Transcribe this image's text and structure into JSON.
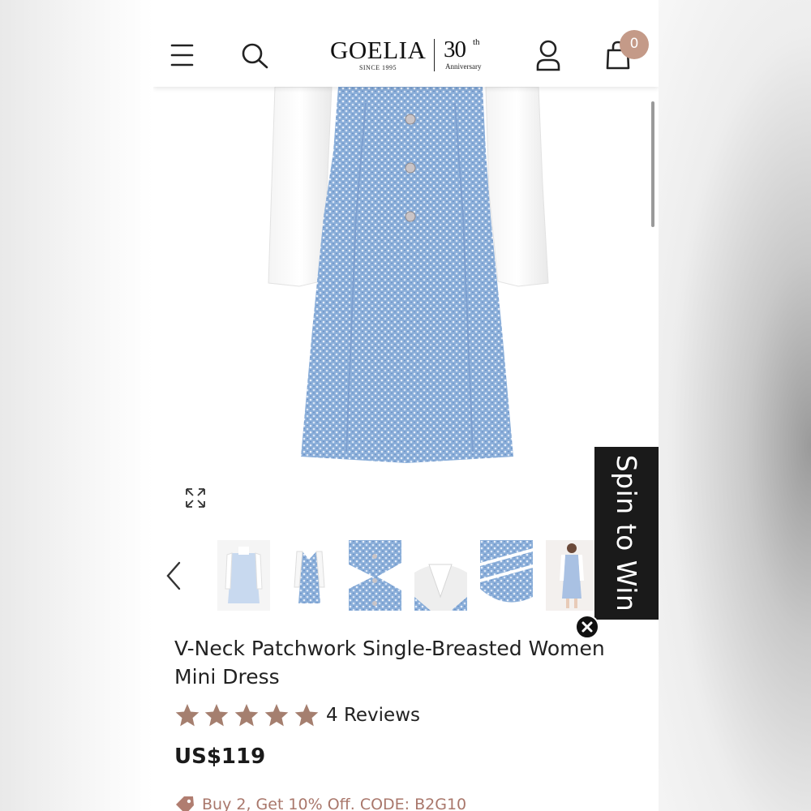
{
  "header": {
    "brand_name": "GOELIA",
    "brand_since": "SINCE 1995",
    "anniversary_number": "30",
    "anniversary_suffix": "th",
    "anniversary_label": "Anniversary",
    "cart_count": "0"
  },
  "icons": {
    "menu": "hamburger-menu-icon",
    "search": "search-icon",
    "account": "user-icon",
    "cart": "shopping-bag-icon",
    "expand": "expand-icon",
    "prev": "chevron-left-icon",
    "close": "close-icon",
    "promo": "tag-icon"
  },
  "spin_banner": {
    "label": "Spin to Win"
  },
  "thumbnails": {
    "count": 6
  },
  "product": {
    "title": "V-Neck Patchwork Single-Breasted Women Mini Dress",
    "rating": 5,
    "rating_max": 5,
    "reviews_label": "4 Reviews",
    "price": "US$119",
    "promo": "Buy 2, Get 10% Off. CODE: B2G10"
  },
  "colors": {
    "accent": "#c49a88",
    "star": "#a57f6f",
    "promo_text": "#a9776b",
    "tweed": "#8fb0da",
    "banner_bg": "#1a1a1a"
  }
}
